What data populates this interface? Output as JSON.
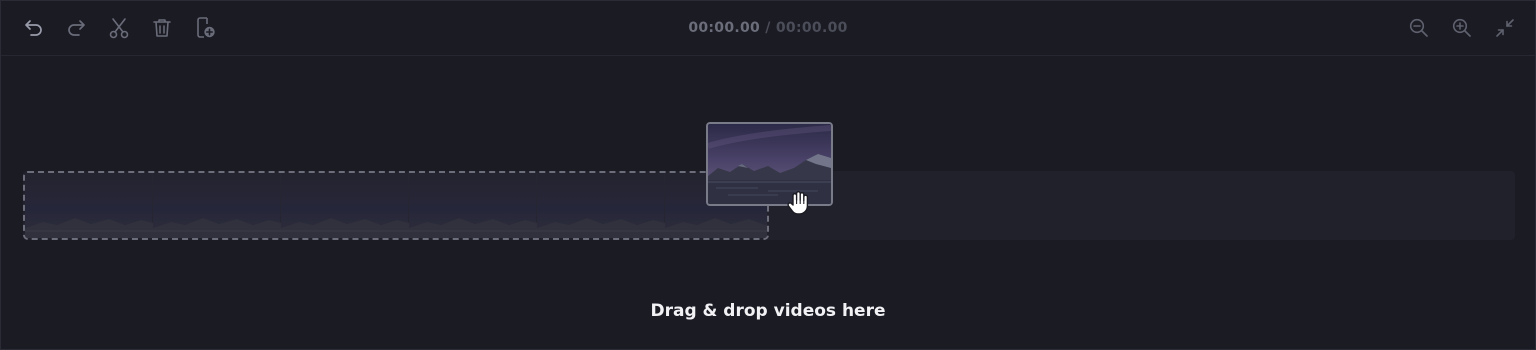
{
  "toolbar": {
    "left_tools": [
      {
        "name": "undo-icon",
        "state": "enabled"
      },
      {
        "name": "redo-icon",
        "state": "disabled"
      },
      {
        "name": "scissors-icon",
        "state": "disabled"
      },
      {
        "name": "trash-icon",
        "state": "disabled"
      },
      {
        "name": "add-clip-icon",
        "state": "disabled"
      }
    ],
    "right_tools": [
      {
        "name": "zoom-out-icon"
      },
      {
        "name": "zoom-in-icon"
      },
      {
        "name": "collapse-icon"
      }
    ],
    "timecode": {
      "current": "00:00.00",
      "separator": "/",
      "total": "00:00.00"
    }
  },
  "timeline": {
    "placeholder_frames": 6,
    "drop_label": "Drag & drop videos here"
  },
  "drag": {
    "thumbnail": "mountain-lake-thumbnail",
    "cursor": "grab-hand-icon"
  },
  "colors": {
    "background": "#1a1b23",
    "track": "#20212b",
    "icon_enabled": "#9a9cab",
    "icon_disabled": "#6a6c7a",
    "timecode_current": "#6b6d7a",
    "timecode_total": "#4b4d59",
    "label": "#f2f2f5"
  }
}
